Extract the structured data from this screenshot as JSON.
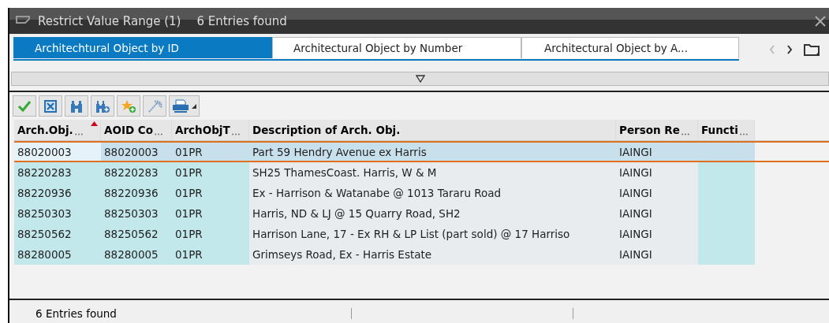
{
  "window": {
    "title": "Restrict Value Range (1)",
    "subtitle": "6 Entries found"
  },
  "tabs": [
    {
      "label": "Architechtural Object by ID",
      "selected": true
    },
    {
      "label": "Architectural Object by Number",
      "selected": false
    },
    {
      "label": "Architectural Object by A...",
      "selected": false
    }
  ],
  "toolbar": [
    {
      "kind": "check"
    },
    {
      "kind": "cancel"
    },
    {
      "kind": "find"
    },
    {
      "kind": "find-next"
    },
    {
      "kind": "favorite-add"
    },
    {
      "kind": "magic"
    },
    {
      "kind": "print"
    }
  ],
  "table": {
    "columns": [
      {
        "label": "Arch.Obj.",
        "truncated": true,
        "sorted": true,
        "key": true
      },
      {
        "label": "AOID Co",
        "truncated": true,
        "sorted": false,
        "key": true
      },
      {
        "label": "ArchObjT",
        "truncated": true,
        "sorted": false,
        "key": true
      },
      {
        "label": "Description of Arch. Obj.",
        "truncated": false,
        "sorted": false,
        "key": false
      },
      {
        "label": "Person Re",
        "truncated": true,
        "sorted": false,
        "key": false
      },
      {
        "label": "Functi",
        "truncated": true,
        "sorted": false,
        "key": true
      }
    ],
    "rows": [
      {
        "selected": true,
        "cells": [
          "88020003",
          "88020003",
          "01PR",
          "Part 59 Hendry Avenue ex Harris",
          "IAINGI",
          ""
        ]
      },
      {
        "selected": false,
        "cells": [
          "88220283",
          "88220283",
          "01PR",
          "SH25 ThamesCoast. Harris, W & M",
          "IAINGI",
          ""
        ]
      },
      {
        "selected": false,
        "cells": [
          "88220936",
          "88220936",
          "01PR",
          "Ex - Harrison & Watanabe @ 1013 Tararu Road",
          "IAINGI",
          ""
        ]
      },
      {
        "selected": false,
        "cells": [
          "88250303",
          "88250303",
          "01PR",
          "Harris, ND & LJ @ 15 Quarry Road, SH2",
          "IAINGI",
          ""
        ]
      },
      {
        "selected": false,
        "cells": [
          "88250562",
          "88250562",
          "01PR",
          "Harrison Lane, 17 - Ex RH & LP List (part sold) @ 17 Harriso",
          "IAINGI",
          ""
        ]
      },
      {
        "selected": false,
        "cells": [
          "88280005",
          "88280005",
          "01PR",
          "Grimseys Road, Ex - Harris Estate",
          "IAINGI",
          ""
        ]
      }
    ]
  },
  "status_bar": {
    "text": "6 Entries found"
  }
}
